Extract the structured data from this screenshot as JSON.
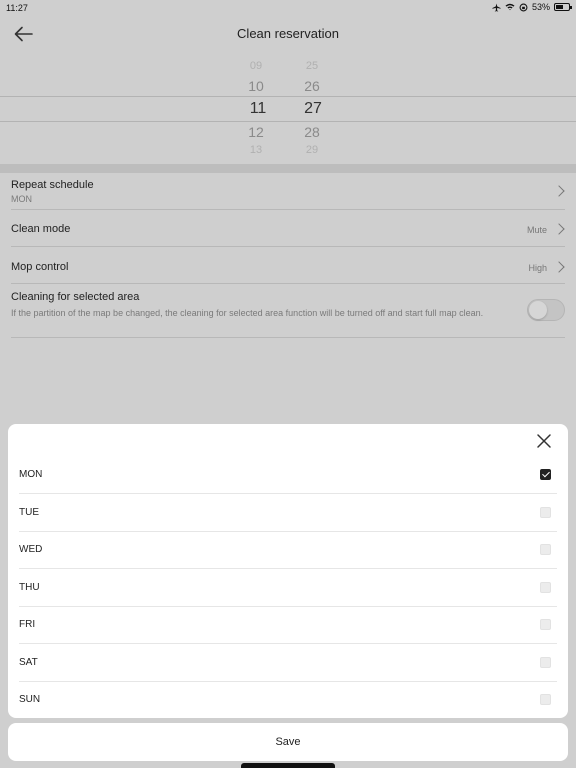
{
  "status_bar": {
    "time": "11:27",
    "battery": "53%",
    "icons": [
      "airplane-icon",
      "wifi-icon",
      "rotation-lock-icon",
      "battery-icon"
    ]
  },
  "header": {
    "title": "Clean reservation",
    "back_icon": "back-arrow-icon"
  },
  "time_picker": {
    "hours": [
      "09",
      "10",
      "11",
      "12",
      "13"
    ],
    "minutes": [
      "25",
      "26",
      "27",
      "28",
      "29"
    ],
    "selected_hour": "11",
    "selected_minute": "27"
  },
  "settings": {
    "repeat": {
      "label": "Repeat schedule",
      "value": "MON"
    },
    "clean_mode": {
      "label": "Clean mode",
      "value": "Mute"
    },
    "mop_control": {
      "label": "Mop control",
      "value": "High"
    },
    "selected_area": {
      "label": "Cleaning for selected area",
      "description": "If the partition of the map be changed, the cleaning for selected area function will be turned off and start full map clean.",
      "enabled": false
    }
  },
  "day_sheet": {
    "close_icon": "close-icon",
    "days": [
      {
        "label": "MON",
        "checked": true
      },
      {
        "label": "TUE",
        "checked": false
      },
      {
        "label": "WED",
        "checked": false
      },
      {
        "label": "THU",
        "checked": false
      },
      {
        "label": "FRI",
        "checked": false
      },
      {
        "label": "SAT",
        "checked": false
      },
      {
        "label": "SUN",
        "checked": false
      }
    ]
  },
  "save_label": "Save"
}
